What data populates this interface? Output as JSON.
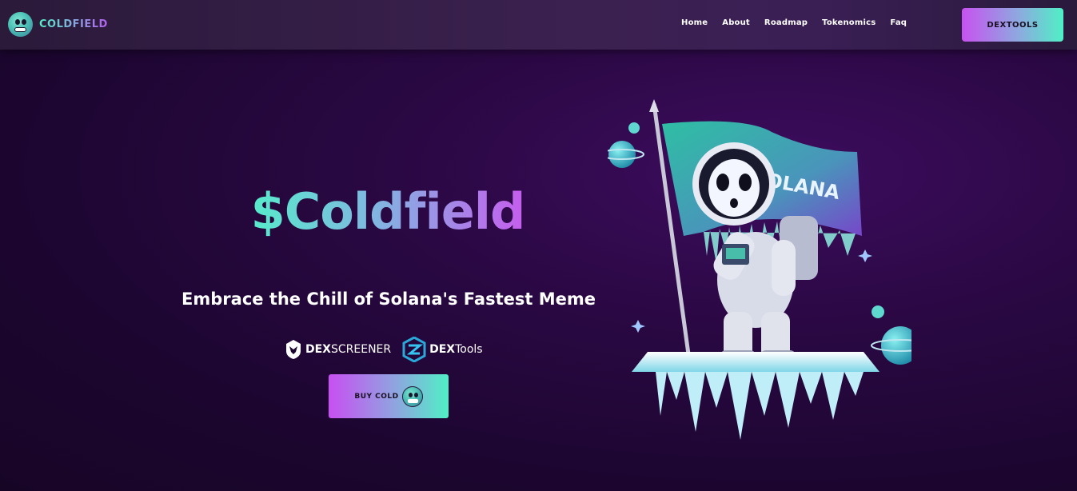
{
  "nav": {
    "brand": "COLDFIELD",
    "menu": [
      "Home",
      "About",
      "Roadmap",
      "Tokenomics",
      "Faq"
    ],
    "cta": "DEXTOOLS"
  },
  "hero": {
    "title": "$Coldfield",
    "subtitle": "Embrace the Chill of Solana's Fastest Meme",
    "partners": [
      {
        "icon": "dexscreener-icon",
        "bold": "DEX",
        "rest": "SCREENER"
      },
      {
        "icon": "dextools-icon",
        "bold": "DEX",
        "rest": "Tools"
      }
    ],
    "buy_label": "BUY COLD",
    "flag_text": "SOLANA"
  },
  "colors": {
    "accent_pink": "#c84ff2",
    "accent_teal": "#4ff0c6",
    "background": "#1c0630"
  }
}
